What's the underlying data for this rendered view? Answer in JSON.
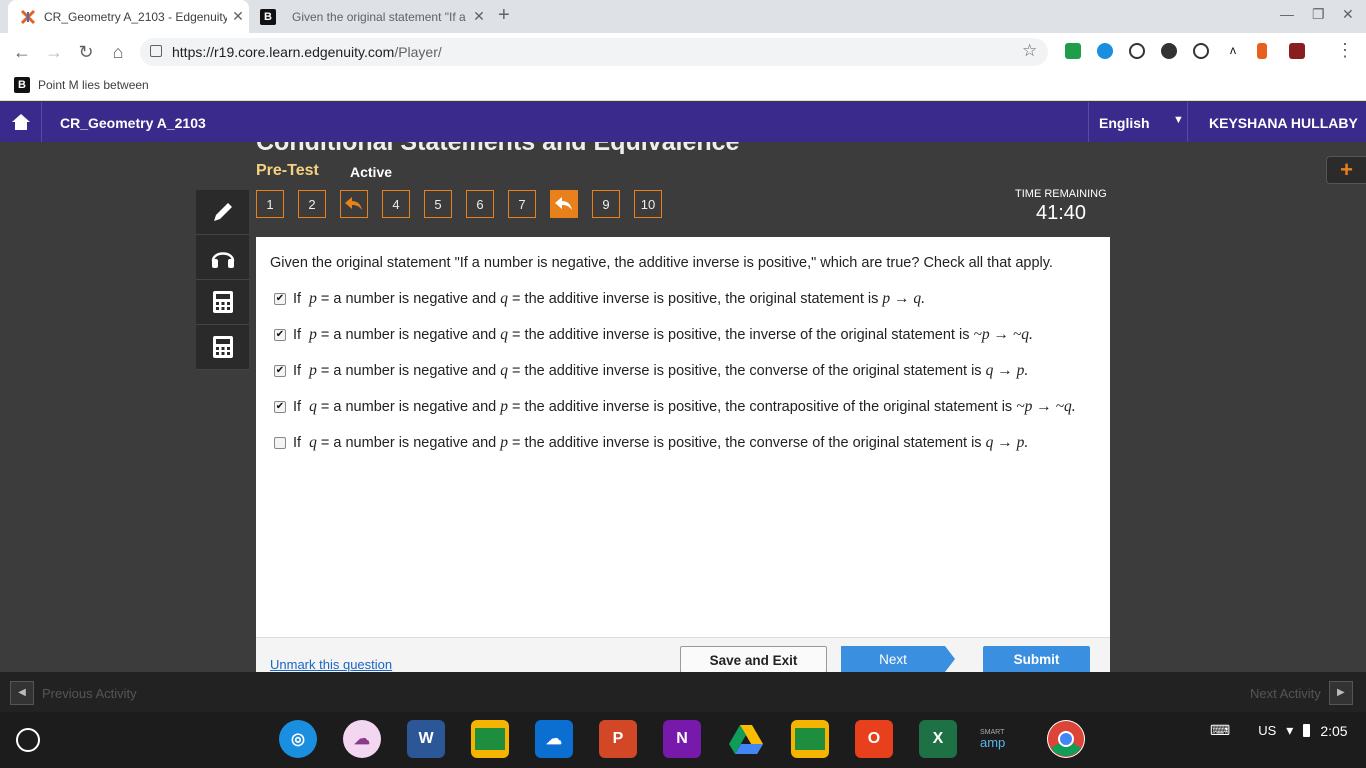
{
  "browser": {
    "tabs": [
      {
        "title": "CR_Geometry A_2103 - Edgenuity"
      },
      {
        "title": "Given the original statement \"If a"
      }
    ],
    "url_host": "https://r19.core.learn.edgenuity.com",
    "url_path": "/Player/",
    "bookmark": "Point M lies between"
  },
  "app": {
    "course": "CR_Geometry A_2103",
    "language": "English",
    "user": "KEYSHANA HULLABY"
  },
  "lesson": {
    "title": "Conditional Statements and Equivalence",
    "mode": "Pre-Test",
    "status": "Active"
  },
  "question_nav": {
    "items": [
      "1",
      "2",
      "↩",
      "4",
      "5",
      "6",
      "7",
      "↩",
      "9",
      "10"
    ],
    "current": "8"
  },
  "timer": {
    "label": "TIME REMAINING",
    "value": "41:40"
  },
  "question": {
    "prompt": "Given the original statement \"If a number is negative, the additive inverse is positive,\" which are true? Check all that apply.",
    "options": [
      {
        "checked": true,
        "pre": "If",
        "v1": "p",
        "mid1": "= a number is negative and",
        "v2": "q",
        "mid2": "= the additive inverse is positive, the original statement is",
        "post": "p → q."
      },
      {
        "checked": true,
        "pre": "If",
        "v1": "p",
        "mid1": "= a number is negative and",
        "v2": "q",
        "mid2": "= the additive inverse is positive, the inverse of the original statement is",
        "post": "~p → ~q."
      },
      {
        "checked": true,
        "pre": "If",
        "v1": "p",
        "mid1": "= a number is negative and",
        "v2": "q",
        "mid2": "= the additive inverse is positive, the converse of the original statement is",
        "post": "q → p."
      },
      {
        "checked": true,
        "pre": "If",
        "v1": "q",
        "mid1": "= a number is negative and",
        "v2": "p",
        "mid2": "= the additive inverse is positive, the contrapositive of the original statement is",
        "post": "~p → ~q."
      },
      {
        "checked": false,
        "pre": "If",
        "v1": "q",
        "mid1": "= a number is negative and",
        "v2": "p",
        "mid2": "= the additive inverse is positive, the converse of the original statement is",
        "post": "q → p."
      }
    ]
  },
  "footer": {
    "unmark": "Unmark this question",
    "save": "Save and Exit",
    "next": "Next",
    "submit": "Submit"
  },
  "activity": {
    "prev": "Previous Activity",
    "next": "Next Activity"
  },
  "shelf": {
    "locale": "US",
    "time": "2:05",
    "smart": "SMART",
    "amp": "amp"
  },
  "colors": {
    "header": "#3a2a8c",
    "accent": "#e8801c",
    "button": "#3b8fe0"
  }
}
